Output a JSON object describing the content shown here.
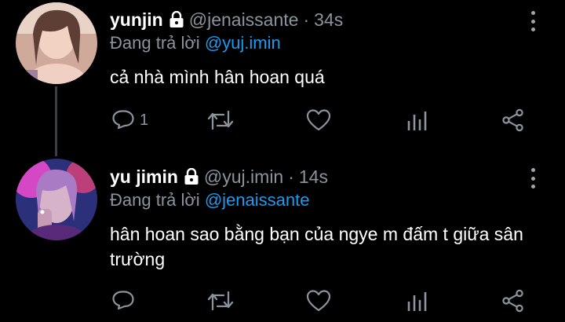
{
  "tweets": [
    {
      "display_name": "yunjin",
      "handle": "@jenaissante",
      "separator": "·",
      "time": "34s",
      "reply_prefix": "Đang trả lời",
      "reply_to": "@yuj.imin",
      "text": "cả nhà mình hân hoan quá",
      "reply_count": "1",
      "avatar_colors": [
        "#c99f90",
        "#f2d6c8",
        "#6b4f45"
      ]
    },
    {
      "display_name": "yu jimin",
      "handle": "@yuj.imin",
      "separator": "·",
      "time": "14s",
      "reply_prefix": "Đang trả lời",
      "reply_to": "@jenaissante",
      "text": "hân hoan sao bằng bạn của ngye m đấm t giữa sân trường",
      "reply_count": "",
      "avatar_colors": [
        "#7b3fa0",
        "#ff4fd8",
        "#2c2f7a"
      ]
    }
  ],
  "icons": {
    "lock": "lock-icon",
    "more": "more-vertical-icon",
    "reply": "reply-icon",
    "retweet": "retweet-icon",
    "like": "heart-icon",
    "stats": "stats-icon",
    "share": "share-icon"
  },
  "colors": {
    "background": "#000000",
    "text": "#ffffff",
    "secondary": "#8b949e",
    "link": "#1d9bf0",
    "icon": "#8b949e",
    "thread_line": "#3a3f44"
  }
}
